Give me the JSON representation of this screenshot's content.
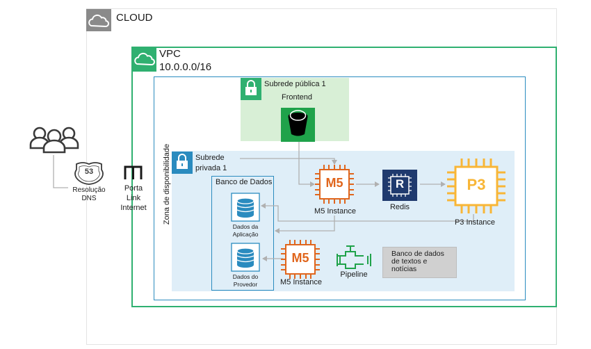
{
  "cloud": {
    "label": "CLOUD"
  },
  "vpc": {
    "label": "VPC",
    "cidr": "10.0.0.0/16"
  },
  "availability_zone": {
    "label": "Zona de disponibilidade"
  },
  "public_subnet": {
    "label": "Subrede pública 1",
    "frontend": "Frontend"
  },
  "private_subnet": {
    "line1": "Subrede",
    "line2": "privada 1"
  },
  "database": {
    "label": "Banco de Dados",
    "app_data": {
      "line1": "Dados da",
      "line2": "Aplicação"
    },
    "provider_data": {
      "line1": "Dados do",
      "line2": "Provedor"
    }
  },
  "dns": {
    "badge": "53",
    "line1": "Resolução",
    "line2": "DNS"
  },
  "gateway": {
    "line1": "Porta",
    "line2": "Link",
    "line3": "Internet"
  },
  "m5_top": {
    "chip": "M5",
    "label": "M5 Instance"
  },
  "m5_bottom": {
    "chip": "M5",
    "label": "M5 Instance"
  },
  "redis": {
    "chip": "R",
    "label": "Redis"
  },
  "p3": {
    "chip": "P3",
    "label": "P3 Instance"
  },
  "pipeline": {
    "label": "Pipeline"
  },
  "text_db": {
    "line1": "Banco de dados",
    "line2": "de textos e",
    "line3": "notícias"
  },
  "colors": {
    "green": "#2fb070",
    "blue": "#2a8bbf",
    "orange": "#e0651c",
    "redis": "#1f3a6e",
    "p3": "#f8b637",
    "connector": "#b0b0b0"
  }
}
